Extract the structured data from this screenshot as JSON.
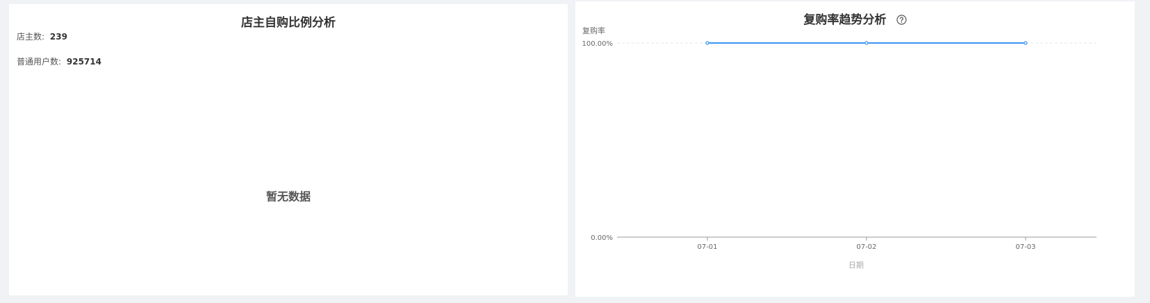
{
  "left_panel": {
    "title": "店主自购比例分析",
    "stats": [
      {
        "label": "店主数:",
        "value": "239"
      },
      {
        "label": "普通用户数:",
        "value": "925714"
      }
    ],
    "empty_text": "暂无数据"
  },
  "right_panel": {
    "title": "复购率趋势分析",
    "help_icon": "question-circle-icon"
  },
  "chart_data": {
    "type": "line",
    "title": "复购率趋势分析",
    "ylabel": "复购率",
    "xlabel": "日期",
    "categories": [
      "07-01",
      "07-02",
      "07-03"
    ],
    "series": [
      {
        "values": [
          100,
          100,
          100
        ]
      }
    ],
    "ylim": [
      0,
      100
    ],
    "y_ticks": [
      "0.00%",
      "100.00%"
    ],
    "y_unit": "%",
    "grid": true,
    "legend": "none",
    "colors": {
      "line": "#3a94f5",
      "axis": "#999999",
      "grid": "#e6e6e6",
      "label": "#666666"
    }
  }
}
